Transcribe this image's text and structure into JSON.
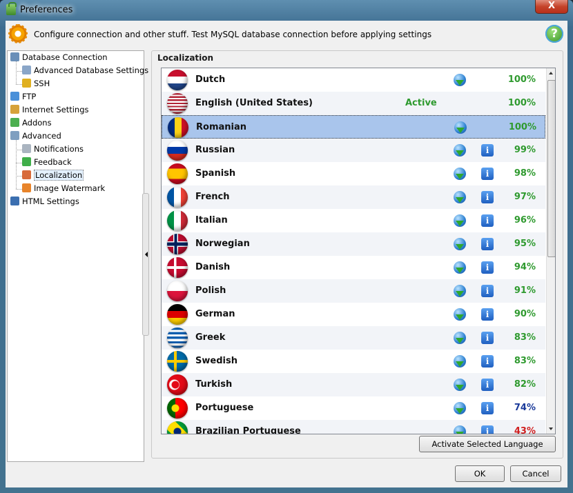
{
  "window": {
    "title": "Preferences",
    "close_label": "X"
  },
  "header": {
    "description": "Configure connection and other stuff. Test MySQL database connection before applying settings",
    "help_label": "?"
  },
  "sidebar": {
    "items": [
      {
        "label": "Database Connection",
        "icon": "database-icon",
        "color": "#6a8fb8"
      },
      {
        "label": "Advanced Database Settings",
        "icon": "db-settings-icon",
        "color": "#8aa6c8"
      },
      {
        "label": "SSH",
        "icon": "lock-icon",
        "color": "#e0b020"
      },
      {
        "label": "FTP",
        "icon": "ftp-icon",
        "color": "#4a90d9"
      },
      {
        "label": "Internet Settings",
        "icon": "internet-icon",
        "color": "#d6a23a"
      },
      {
        "label": "Addons",
        "icon": "puzzle-icon",
        "color": "#4caf50"
      },
      {
        "label": "Advanced",
        "icon": "shield-icon",
        "color": "#7f9fc0"
      },
      {
        "label": "Notifications",
        "icon": "notification-icon",
        "color": "#aab4c0"
      },
      {
        "label": "Feedback",
        "icon": "feedback-icon",
        "color": "#3fae49"
      },
      {
        "label": "Localization",
        "icon": "localization-icon",
        "color": "#d86a3a"
      },
      {
        "label": "Image Watermark",
        "icon": "image-icon",
        "color": "#e8842a"
      },
      {
        "label": "HTML Settings",
        "icon": "html-icon",
        "color": "#3b6fb0"
      }
    ]
  },
  "localization": {
    "group_title": "Localization",
    "languages": [
      {
        "name": "Dutch",
        "status": "",
        "percent": "100%",
        "pct_color": "#2f9a2f",
        "flag": "nl"
      },
      {
        "name": "English (United States)",
        "status": "Active",
        "percent": "100%",
        "pct_color": "#2f9a2f",
        "flag": "us"
      },
      {
        "name": "Romanian",
        "status": "",
        "percent": "100%",
        "pct_color": "#2f9a2f",
        "flag": "ro"
      },
      {
        "name": "Russian",
        "status": "",
        "percent": "99%",
        "pct_color": "#2f9a2f",
        "flag": "ru"
      },
      {
        "name": "Spanish",
        "status": "",
        "percent": "98%",
        "pct_color": "#2f9a2f",
        "flag": "es"
      },
      {
        "name": "French",
        "status": "",
        "percent": "97%",
        "pct_color": "#2f9a2f",
        "flag": "fr"
      },
      {
        "name": "Italian",
        "status": "",
        "percent": "96%",
        "pct_color": "#2f9a2f",
        "flag": "it"
      },
      {
        "name": "Norwegian",
        "status": "",
        "percent": "95%",
        "pct_color": "#2f9a2f",
        "flag": "no"
      },
      {
        "name": "Danish",
        "status": "",
        "percent": "94%",
        "pct_color": "#2f9a2f",
        "flag": "dk"
      },
      {
        "name": "Polish",
        "status": "",
        "percent": "91%",
        "pct_color": "#2f9a2f",
        "flag": "pl"
      },
      {
        "name": "German",
        "status": "",
        "percent": "90%",
        "pct_color": "#2f9a2f",
        "flag": "de"
      },
      {
        "name": "Greek",
        "status": "",
        "percent": "83%",
        "pct_color": "#2f9a2f",
        "flag": "gr"
      },
      {
        "name": "Swedish",
        "status": "",
        "percent": "83%",
        "pct_color": "#2f9a2f",
        "flag": "se"
      },
      {
        "name": "Turkish",
        "status": "",
        "percent": "82%",
        "pct_color": "#2f9a2f",
        "flag": "tr"
      },
      {
        "name": "Portuguese",
        "status": "",
        "percent": "74%",
        "pct_color": "#1a3a9a",
        "flag": "pt"
      },
      {
        "name": "Brazilian Portuguese",
        "status": "",
        "percent": "43%",
        "pct_color": "#d02020",
        "flag": "br"
      }
    ],
    "selected_index": 2,
    "activate_button": "Activate Selected Language"
  },
  "footer": {
    "ok_label": "OK",
    "cancel_label": "Cancel"
  }
}
